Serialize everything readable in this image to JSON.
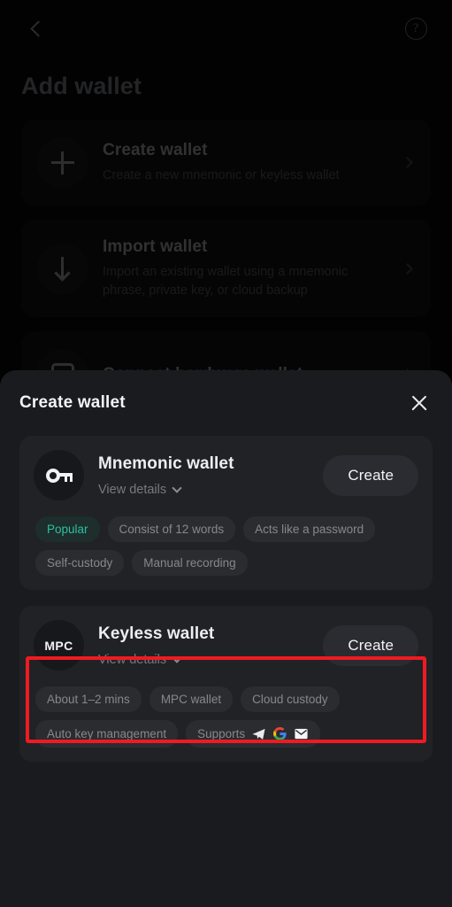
{
  "background_page": {
    "back_icon": "chevron-left-icon",
    "help_icon": "help-circle-icon",
    "title": "Add wallet",
    "cards": [
      {
        "icon": "plus-icon",
        "title": "Create wallet",
        "subtitle": "Create a new mnemonic or keyless wallet",
        "chevron": "chevron-right-icon"
      },
      {
        "icon": "arrow-down-icon",
        "title": "Import wallet",
        "subtitle": "Import an existing wallet using a mnemonic phrase, private key, or cloud backup",
        "chevron": "chevron-right-icon"
      },
      {
        "icon": "hardware-icon",
        "title": "Connect hardware wallet",
        "subtitle": "",
        "chevron": "chevron-right-icon"
      }
    ]
  },
  "modal": {
    "title": "Create wallet",
    "close_icon": "close-icon",
    "options": [
      {
        "badge_icon": "key-icon",
        "badge_text": "",
        "title": "Mnemonic wallet",
        "details_label": "View details",
        "details_chevron": "chevron-down-icon",
        "action_label": "Create",
        "tags": [
          {
            "label": "Popular",
            "accent": true
          },
          {
            "label": "Consist of 12 words",
            "accent": false
          },
          {
            "label": "Acts like a password",
            "accent": false
          },
          {
            "label": "Self-custody",
            "accent": false
          },
          {
            "label": "Manual recording",
            "accent": false
          }
        ]
      },
      {
        "badge_icon": "mpc-icon",
        "badge_text": "MPC",
        "title": "Keyless wallet",
        "details_label": "View details",
        "details_chevron": "chevron-down-icon",
        "action_label": "Create",
        "tags": [
          {
            "label": "About 1–2 mins",
            "accent": false
          },
          {
            "label": "MPC wallet",
            "accent": false
          },
          {
            "label": "Cloud custody",
            "accent": false
          },
          {
            "label": "Auto key management",
            "accent": false
          },
          {
            "label": "Supports",
            "accent": false,
            "icons": [
              "telegram-icon",
              "google-icon",
              "email-icon"
            ]
          }
        ]
      }
    ]
  },
  "annotation": {
    "type": "highlight-rectangle",
    "target": "keyless-wallet-option",
    "color": "#ee1b22"
  },
  "colors": {
    "page_background": "#050506",
    "sheet_background": "#1a1b1e",
    "card_background": "#212226",
    "accent_teal": "#2fbfa0",
    "highlight_red": "#ee1b22"
  }
}
